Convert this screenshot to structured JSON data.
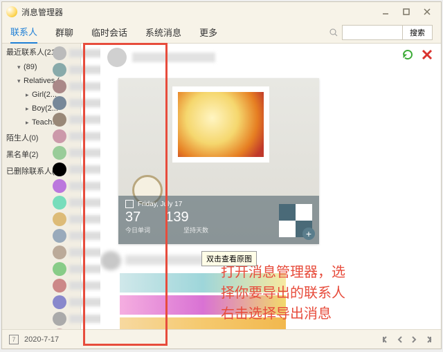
{
  "window": {
    "title": "消息管理器"
  },
  "tabs": {
    "items": [
      "联系人",
      "群聊",
      "临时会话",
      "系统消息",
      "更多"
    ],
    "active_index": 0
  },
  "search": {
    "placeholder": "",
    "button": "搜索"
  },
  "sidebar": {
    "groups": [
      {
        "label": "最近联系人(210)",
        "level": 0
      },
      {
        "label": "(89)",
        "level": 1
      },
      {
        "label": "Relatives.(...",
        "level": 1
      },
      {
        "label": "Girl(2...",
        "level": 2
      },
      {
        "label": "Boy(2...",
        "level": 2
      },
      {
        "label": "Teach...",
        "level": 2
      },
      {
        "label": "陌生人(0)",
        "level": 0
      },
      {
        "label": "黑名单(2)",
        "level": 0
      },
      {
        "label": "已删除联系人(13)",
        "level": 0
      }
    ]
  },
  "contact_avatars": {
    "count": 18
  },
  "chat": {
    "image_overlay": {
      "date_label": "Friday, July 17",
      "stat1": "37",
      "stat2": "139",
      "sub1": "今日单词",
      "sub2": "坚持天数"
    },
    "tooltip": "双击查看原图"
  },
  "annotation": {
    "line1": "打开消息管理器，选",
    "line2": "择你要导出的联系人",
    "line3": "右击选择导出消息"
  },
  "footer": {
    "calendar_day": "7",
    "date": "2020-7-17"
  }
}
